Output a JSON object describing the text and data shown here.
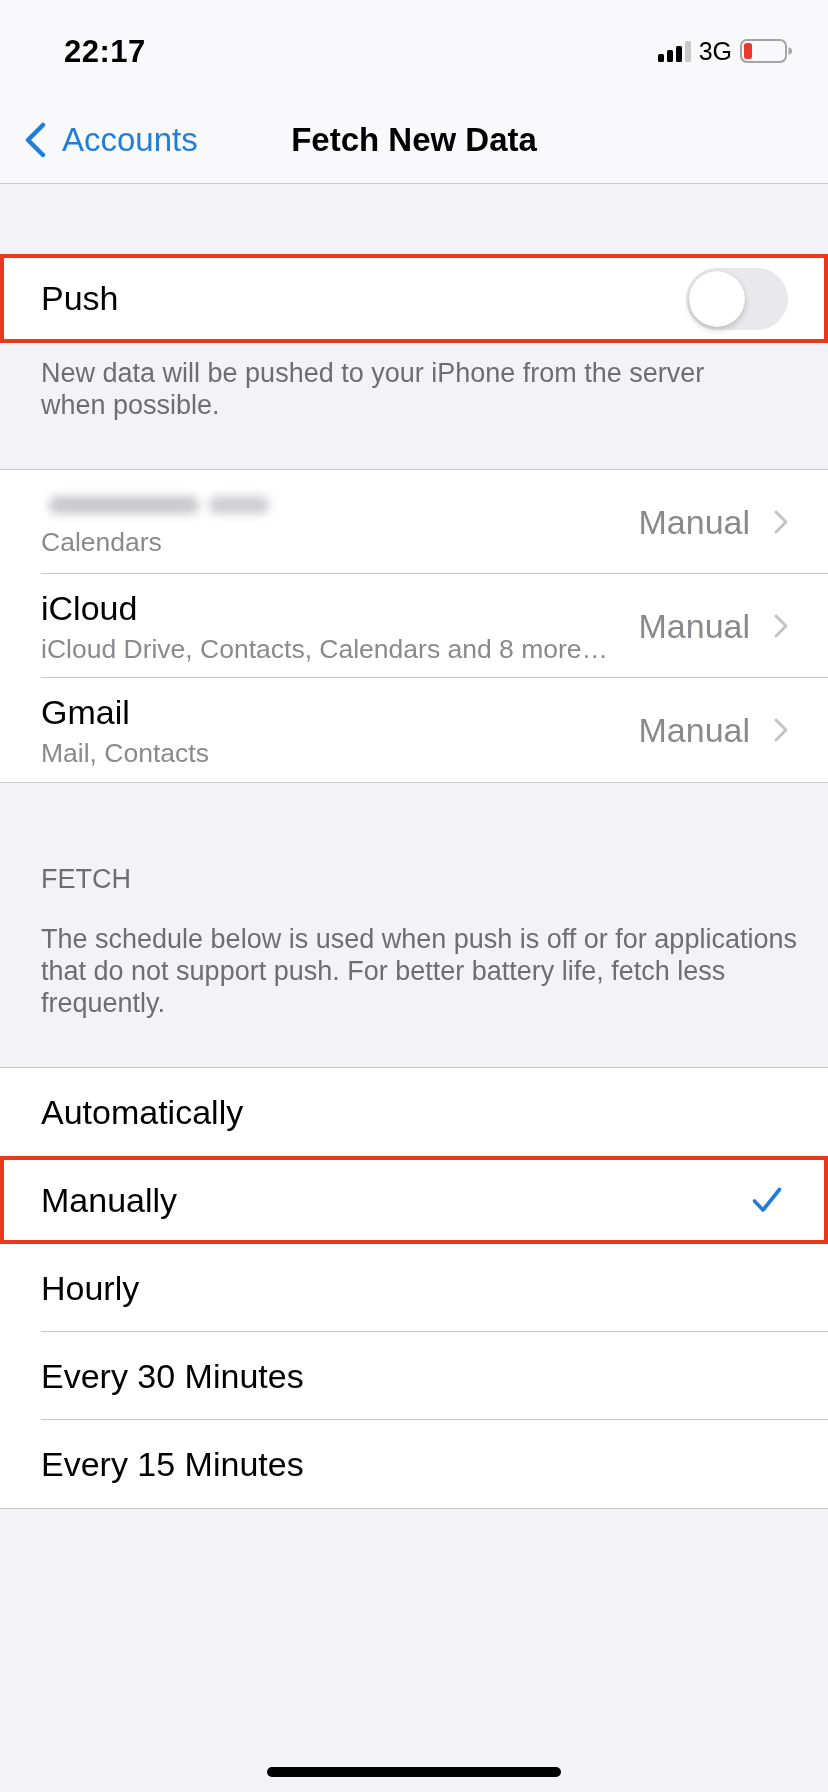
{
  "status_bar": {
    "time": "22:17",
    "network": "3G"
  },
  "nav": {
    "back_label": "Accounts",
    "title": "Fetch New Data"
  },
  "push": {
    "label": "Push",
    "on": false,
    "highlighted": true,
    "footer": "New data will be pushed to your iPhone from the server when possible."
  },
  "accounts": [
    {
      "name_redacted": true,
      "services": "Calendars",
      "value": "Manual"
    },
    {
      "name_redacted": false,
      "name": "iCloud",
      "services": "iCloud Drive, Contacts, Calendars and 8 more…",
      "value": "Manual"
    },
    {
      "name_redacted": false,
      "name": "Gmail",
      "services": "Mail, Contacts",
      "value": "Manual"
    }
  ],
  "fetch": {
    "header": "FETCH",
    "description": "The schedule below is used when push is off or for applications that do not support push. For better battery life, fetch less frequently.",
    "options": [
      {
        "label": "Automatically",
        "selected": false,
        "highlighted": false
      },
      {
        "label": "Manually",
        "selected": true,
        "highlighted": true
      },
      {
        "label": "Hourly",
        "selected": false,
        "highlighted": false
      },
      {
        "label": "Every 30 Minutes",
        "selected": false,
        "highlighted": false
      },
      {
        "label": "Every 15 Minutes",
        "selected": false,
        "highlighted": false
      }
    ]
  }
}
